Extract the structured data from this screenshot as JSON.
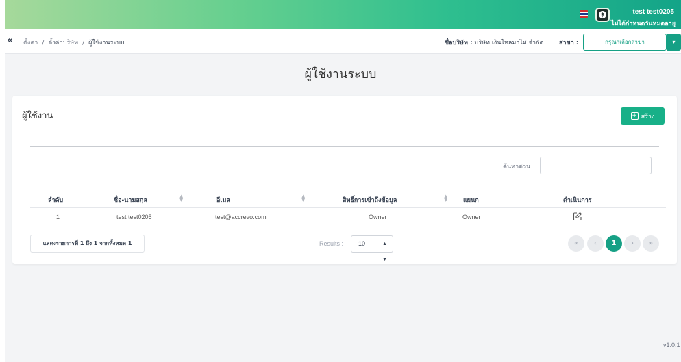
{
  "header": {
    "user_name": "test test0205",
    "user_status": "ไม่ได้กำหนดวันหมดอายุ"
  },
  "subbar": {
    "breadcrumb": [
      "ตั้งค่า",
      "ตั้งค่าบริษัท",
      "ผู้ใช้งานระบบ"
    ],
    "company_label": "ชื่อบริษัท :",
    "company_name": "บริษัท เงินไหลมาไม่ จำกัด",
    "branch_label": "สาขา :",
    "branch_placeholder": "กรุณาเลือกสาขา"
  },
  "page": {
    "title": "ผู้ใช้งานระบบ"
  },
  "card": {
    "title": "ผู้ใช้งาน",
    "create_label": "สร้าง",
    "search_label": "ค้นหาด่วน",
    "search_value": ""
  },
  "table": {
    "columns": [
      "ลำดับ",
      "ชื่อ-นามสกุล",
      "อีเมล",
      "สิทธิ์การเข้าถึงข้อมูล",
      "แผนก",
      "ดำเนินการ"
    ],
    "rows": [
      {
        "index": "1",
        "name": "test test0205",
        "email": "test@accrevo.com",
        "access": "Owner",
        "department": "Owner"
      }
    ]
  },
  "footer": {
    "info": "แสดงรายการที่ 1 ถึง 1 จากทั้งหมด 1",
    "results_label": "Results :",
    "results_value": "10",
    "pagination": {
      "first": "«",
      "prev": "‹",
      "current": "1",
      "next": "›",
      "last": "»"
    }
  },
  "version": "v1.0.1",
  "colors": {
    "accent": "#16a085",
    "topbar_start": "#a6d99b",
    "topbar_end": "#13a488"
  },
  "icons": [
    "collapse-icon",
    "flag-icon",
    "app-icon",
    "plus-icon",
    "sort-icon",
    "edit-icon"
  ]
}
